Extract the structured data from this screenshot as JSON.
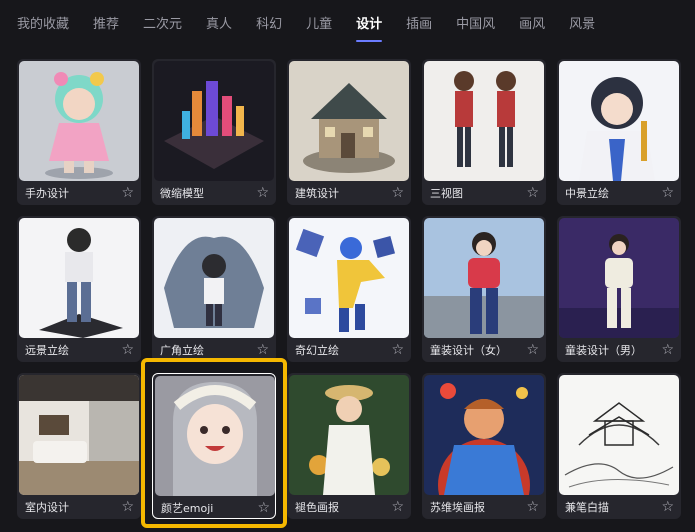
{
  "tabs": [
    "我的收藏",
    "推荐",
    "二次元",
    "真人",
    "科幻",
    "儿童",
    "设计",
    "插画",
    "中国风",
    "画风",
    "风景"
  ],
  "active_tab": "设计",
  "cards": [
    {
      "label": "手办设计",
      "icon": "star-outline-icon"
    },
    {
      "label": "微缩模型",
      "icon": "star-outline-icon"
    },
    {
      "label": "建筑设计",
      "icon": "star-outline-icon"
    },
    {
      "label": "三视图",
      "icon": "star-outline-icon"
    },
    {
      "label": "中景立绘",
      "icon": "star-outline-icon"
    },
    {
      "label": "远景立绘",
      "icon": "star-outline-icon"
    },
    {
      "label": "广角立绘",
      "icon": "star-outline-icon"
    },
    {
      "label": "奇幻立绘",
      "icon": "star-outline-icon"
    },
    {
      "label": "童装设计（女）",
      "icon": "star-outline-icon"
    },
    {
      "label": "童装设计（男）",
      "icon": "star-outline-icon"
    },
    {
      "label": "室内设计",
      "icon": "star-outline-icon"
    },
    {
      "label": "颜艺emoji",
      "icon": "star-outline-icon"
    },
    {
      "label": "褪色画报",
      "icon": "star-outline-icon"
    },
    {
      "label": "苏维埃画报",
      "icon": "star-outline-icon"
    },
    {
      "label": "兼笔白描",
      "icon": "star-outline-icon"
    }
  ],
  "star_glyph": "☆",
  "selected_card": "颜艺emoji",
  "colors": {
    "background": "#17171b",
    "card": "#26262d",
    "highlight": "#f5b800",
    "active_tab_underline": "#6b7cff"
  }
}
